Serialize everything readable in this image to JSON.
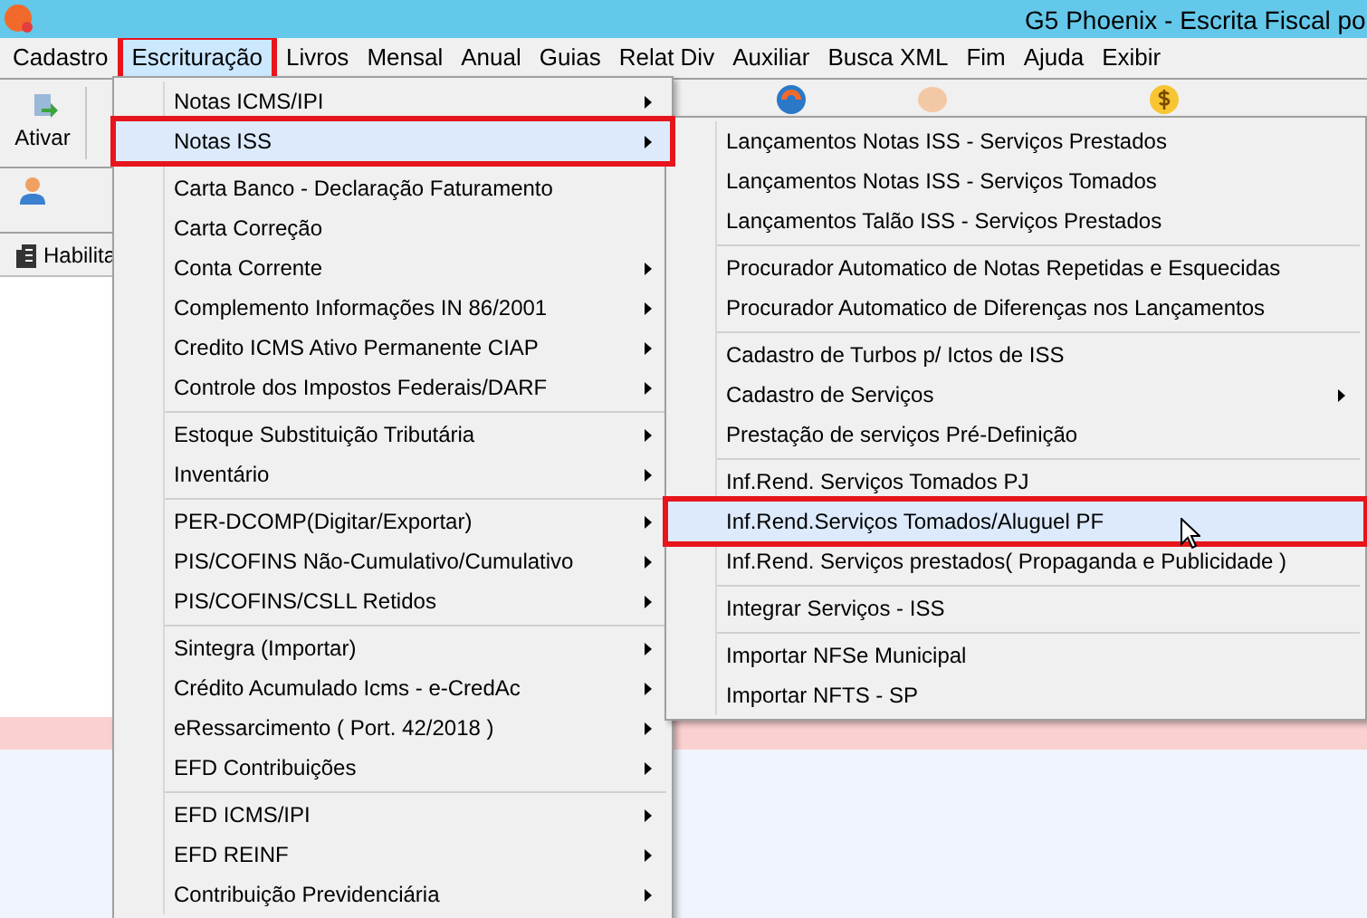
{
  "window": {
    "title": "G5 Phoenix - Escrita Fiscal po"
  },
  "menu_bar": [
    {
      "label": "Cadastro",
      "selected": false
    },
    {
      "label": "Escrituração",
      "selected": true
    },
    {
      "label": "Livros",
      "selected": false
    },
    {
      "label": "Mensal",
      "selected": false
    },
    {
      "label": "Anual",
      "selected": false
    },
    {
      "label": "Guias",
      "selected": false
    },
    {
      "label": "Relat Div",
      "selected": false
    },
    {
      "label": "Auxiliar",
      "selected": false
    },
    {
      "label": "Busca XML",
      "selected": false
    },
    {
      "label": "Fim",
      "selected": false
    },
    {
      "label": "Ajuda",
      "selected": false
    },
    {
      "label": "Exibir",
      "selected": false
    }
  ],
  "toolbar": {
    "button_label": "Ativar"
  },
  "tab": {
    "label": "Habilita"
  },
  "menu": {
    "items": [
      {
        "kind": "item",
        "label": "Notas ICMS/IPI",
        "submenu": true,
        "selected": false
      },
      {
        "kind": "item",
        "label": "Notas ISS",
        "submenu": true,
        "selected": true
      },
      {
        "kind": "separator"
      },
      {
        "kind": "item",
        "label": "Carta Banco - Declaração Faturamento",
        "submenu": false,
        "selected": false
      },
      {
        "kind": "item",
        "label": "Carta Correção",
        "submenu": false,
        "selected": false
      },
      {
        "kind": "item",
        "label": "Conta Corrente",
        "submenu": true,
        "selected": false
      },
      {
        "kind": "item",
        "label": "Complemento Informações IN 86/2001",
        "submenu": true,
        "selected": false
      },
      {
        "kind": "item",
        "label": "Credito ICMS Ativo Permanente CIAP",
        "submenu": true,
        "selected": false
      },
      {
        "kind": "item",
        "label": "Controle dos Impostos Federais/DARF",
        "submenu": true,
        "selected": false
      },
      {
        "kind": "separator"
      },
      {
        "kind": "item",
        "label": "Estoque Substituição Tributária",
        "submenu": true,
        "selected": false
      },
      {
        "kind": "item",
        "label": "Inventário",
        "submenu": true,
        "selected": false
      },
      {
        "kind": "separator"
      },
      {
        "kind": "item",
        "label": "PER-DCOMP(Digitar/Exportar)",
        "submenu": true,
        "selected": false
      },
      {
        "kind": "item",
        "label": "PIS/COFINS Não-Cumulativo/Cumulativo",
        "submenu": true,
        "selected": false
      },
      {
        "kind": "item",
        "label": "PIS/COFINS/CSLL Retidos",
        "submenu": true,
        "selected": false
      },
      {
        "kind": "separator"
      },
      {
        "kind": "item",
        "label": "Sintegra (Importar)",
        "submenu": true,
        "selected": false
      },
      {
        "kind": "item",
        "label": "Crédito Acumulado Icms - e-CredAc",
        "submenu": true,
        "selected": false
      },
      {
        "kind": "item",
        "label": "eRessarcimento ( Port. 42/2018 )",
        "submenu": true,
        "selected": false
      },
      {
        "kind": "item",
        "label": "EFD Contribuições",
        "submenu": true,
        "selected": false
      },
      {
        "kind": "separator"
      },
      {
        "kind": "item",
        "label": "EFD ICMS/IPI",
        "submenu": true,
        "selected": false
      },
      {
        "kind": "item",
        "label": "EFD REINF",
        "submenu": true,
        "selected": false
      },
      {
        "kind": "item",
        "label": "Contribuição Previdenciária",
        "submenu": true,
        "selected": false
      }
    ]
  },
  "submenu": {
    "items": [
      {
        "kind": "item",
        "label": "Lançamentos Notas ISS - Serviços Prestados",
        "submenu": false,
        "selected": false
      },
      {
        "kind": "item",
        "label": "Lançamentos Notas ISS - Serviços Tomados",
        "submenu": false,
        "selected": false
      },
      {
        "kind": "item",
        "label": "Lançamentos Talão ISS - Serviços Prestados",
        "submenu": false,
        "selected": false
      },
      {
        "kind": "separator"
      },
      {
        "kind": "item",
        "label": "Procurador Automatico de Notas Repetidas e Esquecidas",
        "submenu": false,
        "selected": false
      },
      {
        "kind": "item",
        "label": "Procurador Automatico de Diferenças nos Lançamentos",
        "submenu": false,
        "selected": false
      },
      {
        "kind": "separator"
      },
      {
        "kind": "item",
        "label": "Cadastro de Turbos p/ Ictos de ISS",
        "submenu": false,
        "selected": false
      },
      {
        "kind": "item",
        "label": "Cadastro de Serviços",
        "submenu": true,
        "selected": false
      },
      {
        "kind": "item",
        "label": "Prestação de serviços Pré-Definição",
        "submenu": false,
        "selected": false
      },
      {
        "kind": "separator"
      },
      {
        "kind": "item",
        "label": "Inf.Rend. Serviços Tomados PJ",
        "submenu": false,
        "selected": false
      },
      {
        "kind": "item",
        "label": "Inf.Rend.Serviços Tomados/Aluguel PF",
        "submenu": false,
        "selected": true
      },
      {
        "kind": "item",
        "label": "Inf.Rend. Serviços prestados( Propaganda e Publicidade )",
        "submenu": false,
        "selected": false
      },
      {
        "kind": "separator"
      },
      {
        "kind": "item",
        "label": "Integrar Serviços - ISS",
        "submenu": false,
        "selected": false
      },
      {
        "kind": "separator"
      },
      {
        "kind": "item",
        "label": "Importar NFSe Municipal",
        "submenu": false,
        "selected": false
      },
      {
        "kind": "item",
        "label": "Importar NFTS - SP",
        "submenu": false,
        "selected": false
      }
    ]
  }
}
